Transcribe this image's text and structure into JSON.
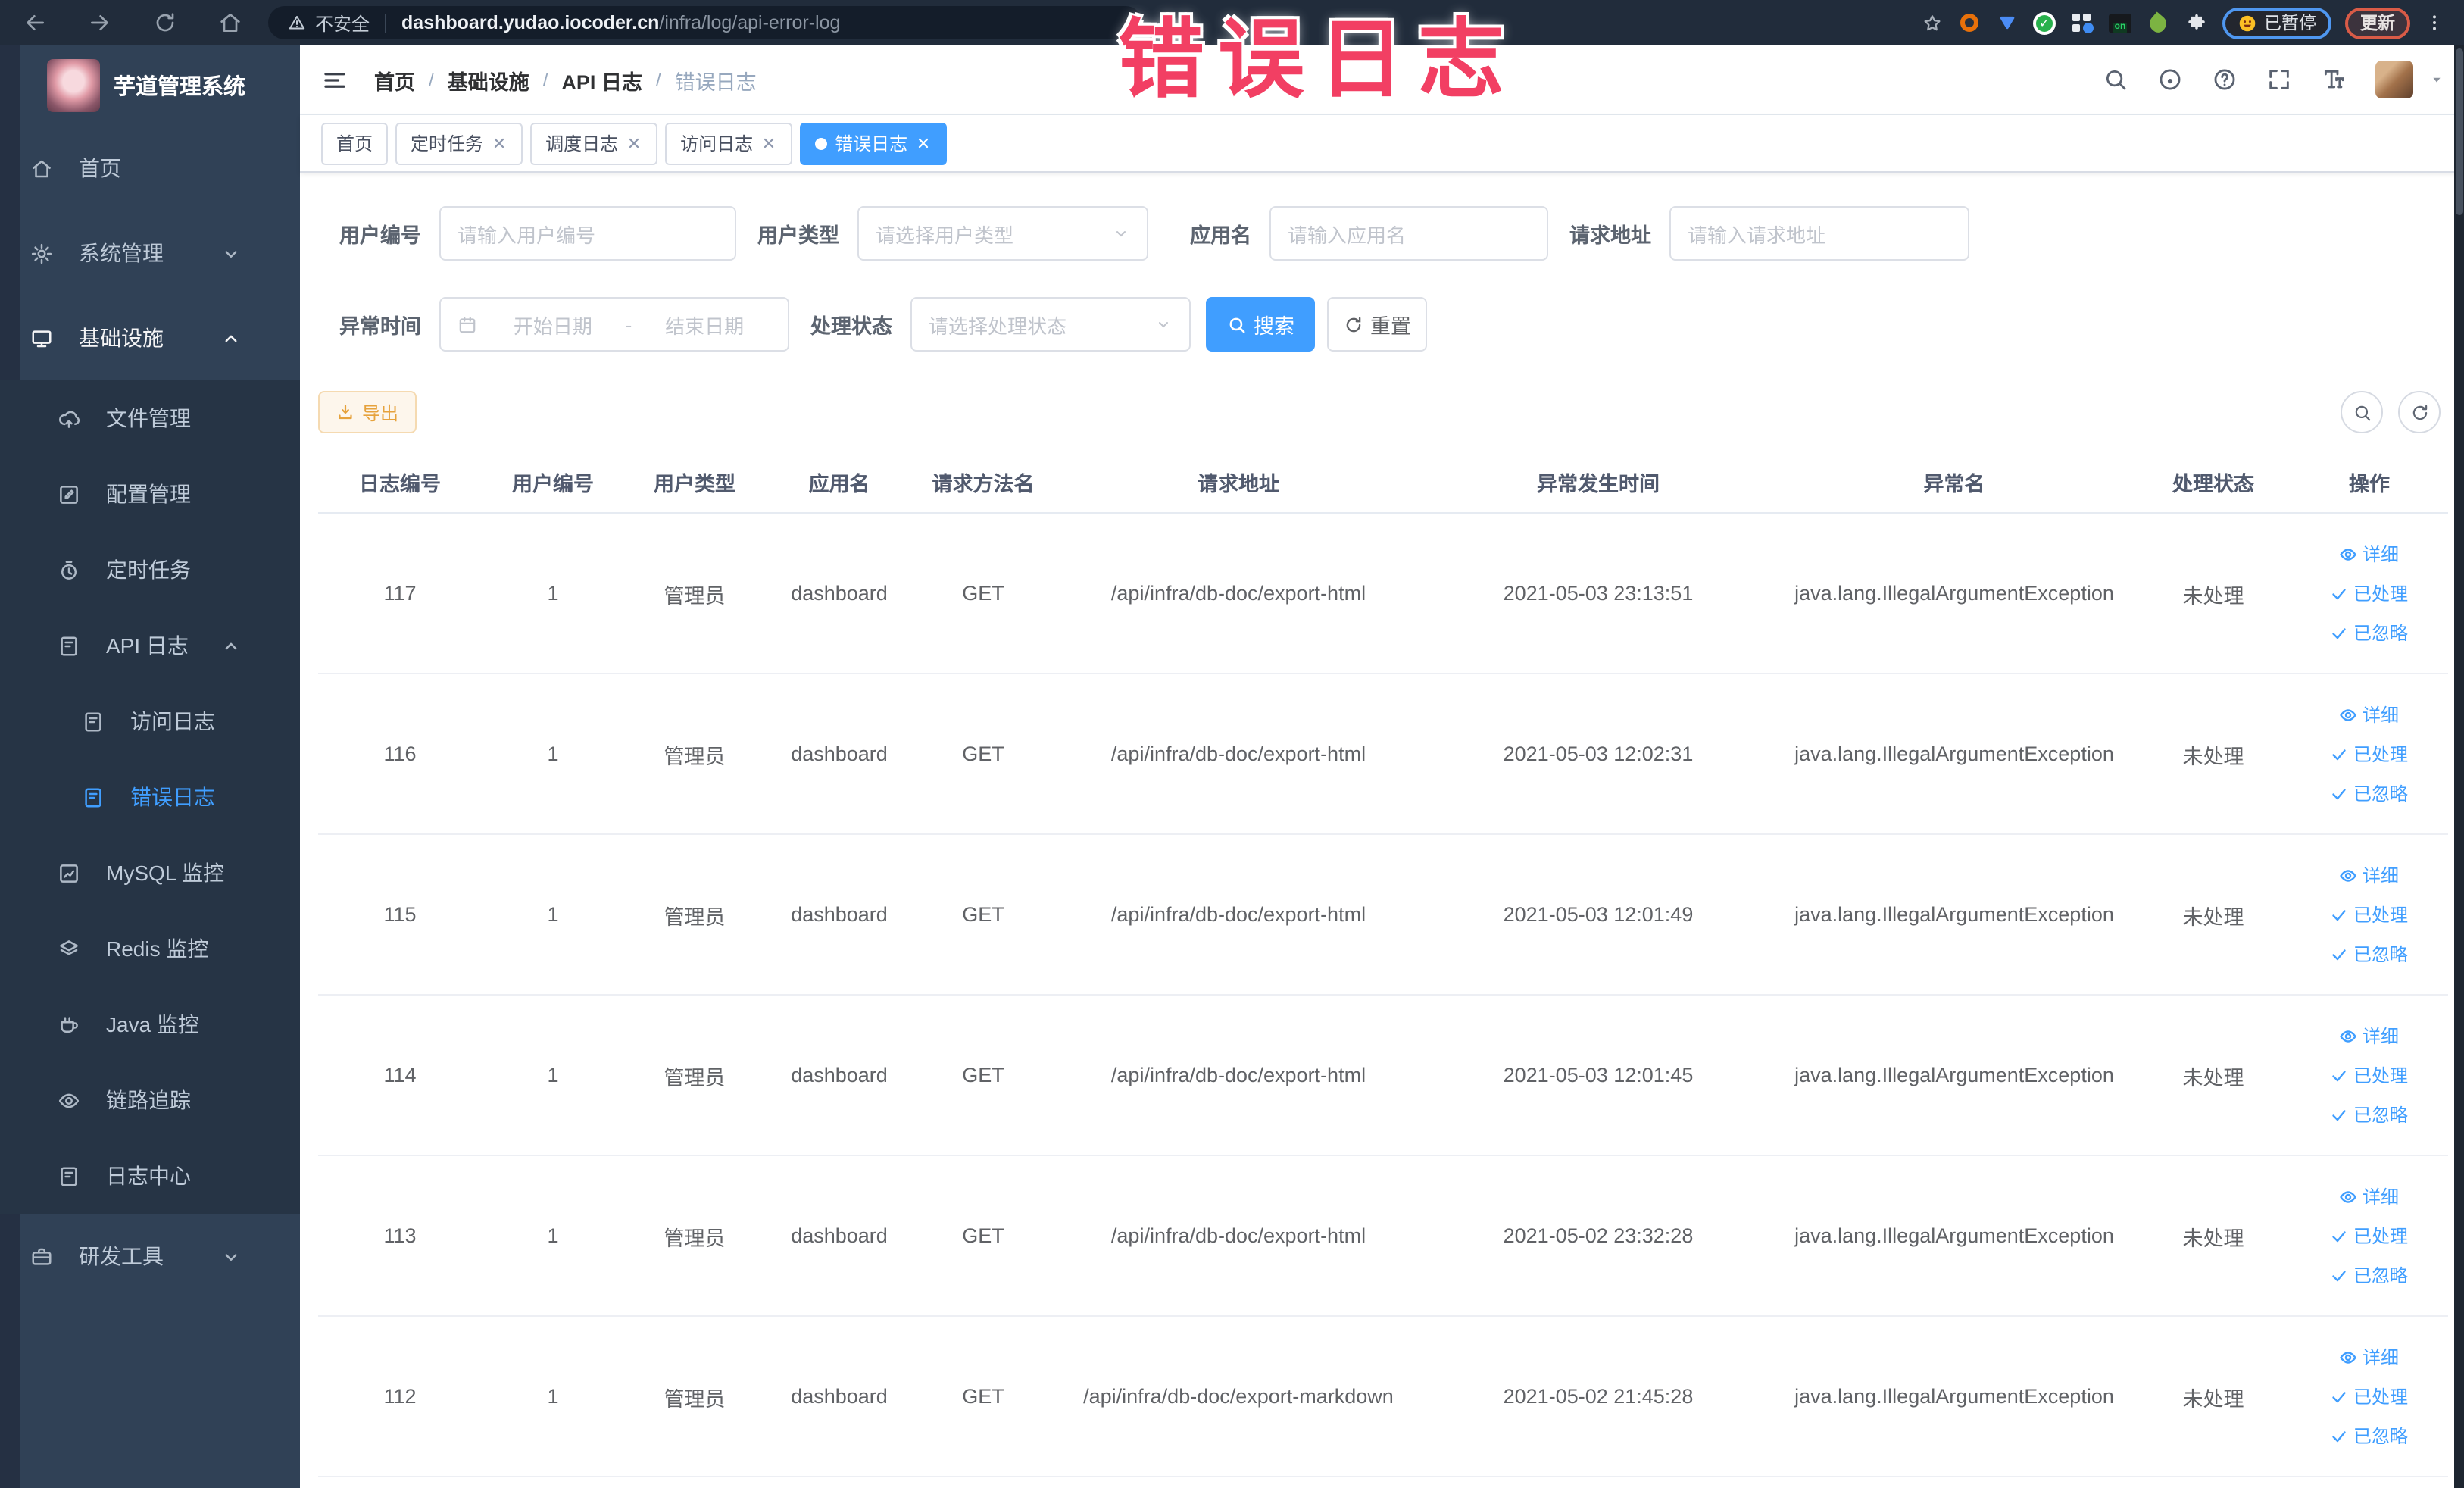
{
  "overlay_title": "错误日志",
  "browser": {
    "security_label": "不安全",
    "url_host": "dashboard.yudao.iocoder.cn",
    "url_path": "/infra/log/api-error-log",
    "on_badge": "on",
    "paused_label": "已暂停",
    "update_label": "更新",
    "nav_icons": [
      "back",
      "forward",
      "reload",
      "home"
    ],
    "extension_icons": [
      "bookmark-star",
      "orange-ring",
      "blue-drop",
      "green-check-circle",
      "grid-drop",
      "on-badge",
      "leaf",
      "puzzle"
    ]
  },
  "sidebar": {
    "brand": "芋道管理系统",
    "items": [
      {
        "name": "home",
        "label": "首页",
        "icon": "home",
        "level": 1,
        "sub": false
      },
      {
        "name": "system-management",
        "label": "系统管理",
        "icon": "gear",
        "level": 1,
        "sub": false,
        "chevron": "down"
      },
      {
        "name": "infrastructure",
        "label": "基础设施",
        "icon": "monitor",
        "level": 1,
        "sub": false,
        "chevron": "up",
        "white": true
      },
      {
        "name": "file-management",
        "label": "文件管理",
        "icon": "cloud-upload",
        "level": 2,
        "sub": true
      },
      {
        "name": "config-management",
        "label": "配置管理",
        "icon": "edit-square",
        "level": 2,
        "sub": true
      },
      {
        "name": "scheduled-tasks",
        "label": "定时任务",
        "icon": "timer",
        "level": 2,
        "sub": true
      },
      {
        "name": "api-log",
        "label": "API 日志",
        "icon": "doc-edit",
        "level": 2,
        "sub": true,
        "chevron": "up"
      },
      {
        "name": "access-log",
        "label": "访问日志",
        "icon": "doc-edit",
        "level": 3,
        "sub": true
      },
      {
        "name": "error-log",
        "label": "错误日志",
        "icon": "doc-edit",
        "level": 3,
        "sub": true,
        "active": true
      },
      {
        "name": "mysql-monitor",
        "label": "MySQL 监控",
        "icon": "chart",
        "level": 2,
        "sub": true
      },
      {
        "name": "redis-monitor",
        "label": "Redis 监控",
        "icon": "layers",
        "level": 2,
        "sub": true
      },
      {
        "name": "java-monitor",
        "label": "Java 监控",
        "icon": "coffee",
        "level": 2,
        "sub": true
      },
      {
        "name": "trace",
        "label": "链路追踪",
        "icon": "eye",
        "level": 2,
        "sub": true
      },
      {
        "name": "log-center",
        "label": "日志中心",
        "icon": "doc-edit",
        "level": 2,
        "sub": true
      },
      {
        "name": "dev-tools",
        "label": "研发工具",
        "icon": "toolbox",
        "level": 1,
        "sub": false,
        "chevron": "down"
      }
    ]
  },
  "header": {
    "breadcrumb": [
      "首页",
      "基础设施",
      "API 日志",
      "错误日志"
    ],
    "right_icons": [
      "search",
      "github",
      "question",
      "fullscreen",
      "font-size"
    ]
  },
  "tabs": [
    {
      "name": "home",
      "label": "首页",
      "closable": false,
      "active": false
    },
    {
      "name": "scheduled-tasks",
      "label": "定时任务",
      "closable": true,
      "active": false
    },
    {
      "name": "schedule-log",
      "label": "调度日志",
      "closable": true,
      "active": false
    },
    {
      "name": "access-log",
      "label": "访问日志",
      "closable": true,
      "active": false
    },
    {
      "name": "error-log",
      "label": "错误日志",
      "closable": true,
      "active": true
    }
  ],
  "filters": {
    "user_id": {
      "label": "用户编号",
      "placeholder": "请输入用户编号"
    },
    "user_type": {
      "label": "用户类型",
      "placeholder": "请选择用户类型"
    },
    "app_name": {
      "label": "应用名",
      "placeholder": "请输入应用名"
    },
    "request_url": {
      "label": "请求地址",
      "placeholder": "请输入请求地址"
    },
    "exception_time": {
      "label": "异常时间",
      "start_placeholder": "开始日期",
      "separator": "-",
      "end_placeholder": "结束日期"
    },
    "process_status": {
      "label": "处理状态",
      "placeholder": "请选择处理状态"
    },
    "search_label": "搜索",
    "reset_label": "重置"
  },
  "toolbar": {
    "export_label": "导出",
    "circle_buttons": [
      {
        "name": "hide-search",
        "icon": "search"
      },
      {
        "name": "refresh",
        "icon": "refresh"
      }
    ]
  },
  "table": {
    "headers": [
      "日志编号",
      "用户编号",
      "用户类型",
      "应用名",
      "请求方法名",
      "请求地址",
      "异常发生时间",
      "异常名",
      "处理状态",
      "操作"
    ],
    "actions": [
      {
        "name": "detail",
        "label": "详细",
        "icon": "eye"
      },
      {
        "name": "processed",
        "label": "已处理",
        "icon": "check"
      },
      {
        "name": "ignored",
        "label": "已忽略",
        "icon": "check"
      }
    ],
    "rows": [
      {
        "id": "117",
        "user_id": "1",
        "user_type": "管理员",
        "app": "dashboard",
        "method": "GET",
        "url": "/api/infra/db-doc/export-html",
        "time": "2021-05-03 23:13:51",
        "exception": "java.lang.IllegalArgumentException",
        "status": "未处理"
      },
      {
        "id": "116",
        "user_id": "1",
        "user_type": "管理员",
        "app": "dashboard",
        "method": "GET",
        "url": "/api/infra/db-doc/export-html",
        "time": "2021-05-03 12:02:31",
        "exception": "java.lang.IllegalArgumentException",
        "status": "未处理"
      },
      {
        "id": "115",
        "user_id": "1",
        "user_type": "管理员",
        "app": "dashboard",
        "method": "GET",
        "url": "/api/infra/db-doc/export-html",
        "time": "2021-05-03 12:01:49",
        "exception": "java.lang.IllegalArgumentException",
        "status": "未处理"
      },
      {
        "id": "114",
        "user_id": "1",
        "user_type": "管理员",
        "app": "dashboard",
        "method": "GET",
        "url": "/api/infra/db-doc/export-html",
        "time": "2021-05-03 12:01:45",
        "exception": "java.lang.IllegalArgumentException",
        "status": "未处理"
      },
      {
        "id": "113",
        "user_id": "1",
        "user_type": "管理员",
        "app": "dashboard",
        "method": "GET",
        "url": "/api/infra/db-doc/export-html",
        "time": "2021-05-02 23:32:28",
        "exception": "java.lang.IllegalArgumentException",
        "status": "未处理"
      },
      {
        "id": "112",
        "user_id": "1",
        "user_type": "管理员",
        "app": "dashboard",
        "method": "GET",
        "url": "/api/infra/db-doc/export-markdown",
        "time": "2021-05-02 21:45:28",
        "exception": "java.lang.IllegalArgumentException",
        "status": "未处理"
      }
    ]
  },
  "colors": {
    "accent": "#409eff",
    "warning": "#e6a23c",
    "sidebar_bg": "#304156",
    "submenu_bg": "#263445",
    "overlay": "#f23f63"
  }
}
